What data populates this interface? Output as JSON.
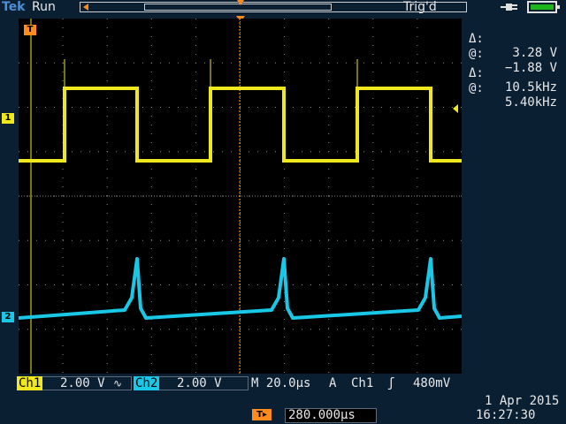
{
  "header": {
    "brand": "Tek",
    "run_state": "Run",
    "trigger_status": "Trig'd"
  },
  "markers": {
    "trigger_time": "T",
    "ch1": "1",
    "ch2": "2"
  },
  "measurements": {
    "voltage_delta_label": "Δ:",
    "voltage_delta_value": "3.28 V",
    "voltage_at_label": "@:",
    "voltage_at_value": "−1.88 V",
    "freq_delta_label": "Δ:",
    "freq_delta_value": "10.5kHz",
    "freq_at_label": "@:",
    "freq_at_value": "5.40kHz"
  },
  "channels": {
    "ch1_tag": "Ch1",
    "ch1_scale": "2.00 V",
    "ch1_bw_icon": "∿",
    "ch2_tag": "Ch2",
    "ch2_scale": "2.00 V"
  },
  "timebase": {
    "label": "M 20.0µs"
  },
  "trigger": {
    "mode": "A",
    "source": "Ch1",
    "edge_icon": "ʃ",
    "level": "480mV"
  },
  "horizontal": {
    "position": "280.000µs"
  },
  "clock": {
    "date": "1 Apr 2015",
    "time": "16:27:30"
  },
  "colors": {
    "ch1": "#f0e81e",
    "ch2": "#19c8e6",
    "trigger": "#ff8c1a",
    "grid": "#8a8a8a",
    "battery": "#1db41d"
  },
  "icons": [
    "plug-icon",
    "battery-icon",
    "trigger-edge-icon",
    "bandwidth-limit-icon"
  ]
}
